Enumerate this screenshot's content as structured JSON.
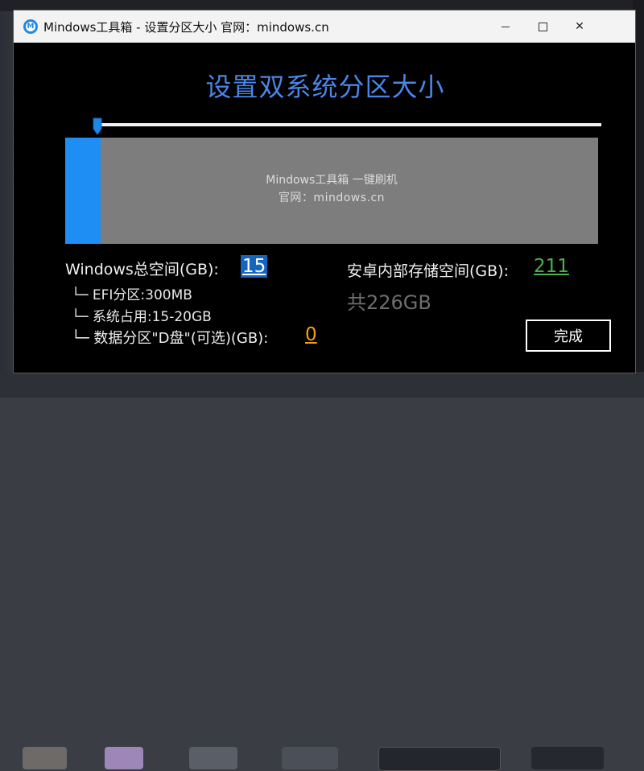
{
  "window": {
    "title": "Mindows工具箱 - 设置分区大小  官网：mindows.cn",
    "icon_letter": "M",
    "controls": {
      "minimize": "minimize-icon",
      "maximize": "maximize-icon",
      "close": "✕"
    }
  },
  "heading": "设置双系统分区大小",
  "slider": {
    "value": 15,
    "max": 226,
    "color": "#1e88e5"
  },
  "partition_bar": {
    "label_line1": "Mindows工具箱 一键刷机",
    "label_line2": "官网：mindows.cn",
    "windows_fraction": 0.066,
    "windows_color": "#1e8ef5",
    "rest_color": "#7d7d7d"
  },
  "left_panel": {
    "windows_label": "Windows总空间(GB):",
    "windows_value": "15",
    "efi": "└─ EFI分区:300MB",
    "system": "└─ 系统占用:15-20GB",
    "data_label": "└─ 数据分区\"D盘\"(可选)(GB):",
    "data_value": "0"
  },
  "right_panel": {
    "android_label": "安卓内部存储空间(GB):",
    "android_value": "211",
    "total": "共226GB"
  },
  "done_button": "完成",
  "colors": {
    "heading": "#4a86e8",
    "accent_blue": "#1565c0",
    "green": "#4caf50",
    "orange": "#f2a20f"
  }
}
